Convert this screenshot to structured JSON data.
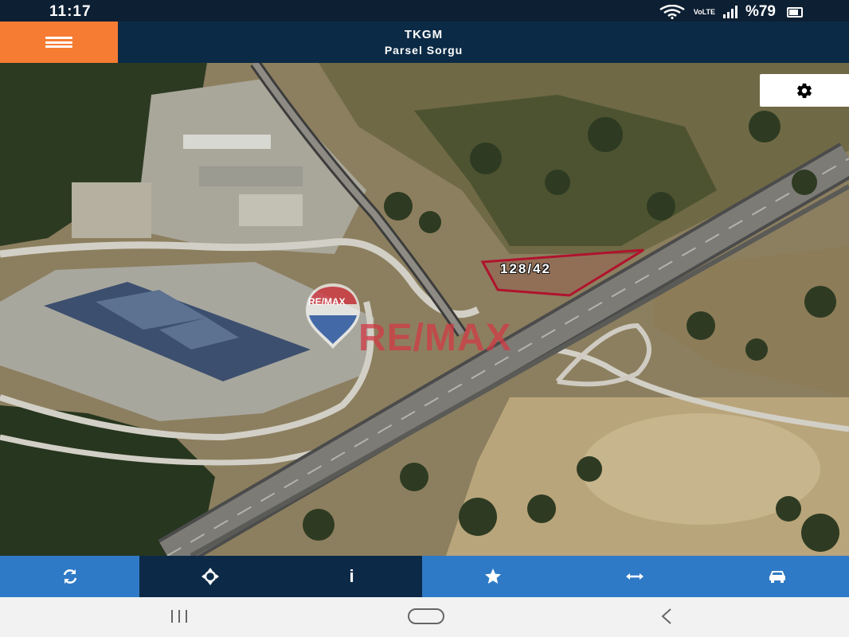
{
  "status_bar": {
    "time": "11:17",
    "network_label": "VoLTE",
    "battery": "%79",
    "icons": [
      "wifi-icon",
      "signal-icon",
      "battery-icon"
    ]
  },
  "header": {
    "title": "TKGM",
    "subtitle": "Parsel Sorgu",
    "menu_icon": "hamburger-icon",
    "menu_color": "#f57c32",
    "bar_color": "#0b2a45"
  },
  "map": {
    "parcel_label": "128/42",
    "parcel_outline_color": "#b0132d",
    "settings_icon": "gear-icon",
    "watermark_text": "RE/MAX",
    "watermark_logo_text": "RE/MAX"
  },
  "toolbar": {
    "buttons": [
      {
        "icon": "refresh-icon"
      },
      {
        "icon": "locate-icon"
      },
      {
        "icon": "info-icon",
        "glyph": "i"
      },
      {
        "icon": "star-icon"
      },
      {
        "icon": "measure-icon"
      },
      {
        "icon": "car-icon"
      }
    ],
    "light_color": "#2f7ac6",
    "dark_color": "#0c2a47"
  },
  "android_nav": {
    "icons": [
      "recent-apps-icon",
      "home-icon",
      "back-icon"
    ]
  }
}
